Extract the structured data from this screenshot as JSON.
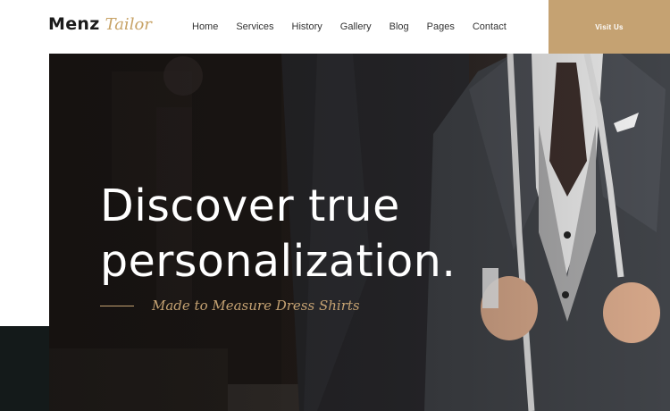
{
  "brand": {
    "name": "Menz",
    "script": "Tailor"
  },
  "nav": {
    "items": [
      {
        "label": "Home"
      },
      {
        "label": "Services"
      },
      {
        "label": "History"
      },
      {
        "label": "Gallery"
      },
      {
        "label": "Blog"
      },
      {
        "label": "Pages"
      },
      {
        "label": "Contact"
      }
    ]
  },
  "cta": {
    "label": "Visit Us"
  },
  "hero": {
    "headline_line1": "Discover true",
    "headline_line2": "personalization.",
    "subheading": "Made to Measure Dress Shirts"
  },
  "colors": {
    "accent": "#c5a272",
    "dark": "#141a1a",
    "text": "#333333"
  }
}
